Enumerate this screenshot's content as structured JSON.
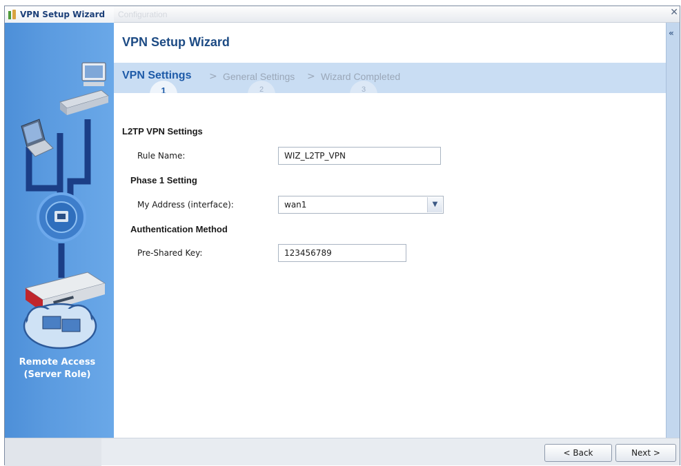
{
  "caption_fragment": "",
  "window": {
    "title": "VPN Setup Wizard",
    "ghost_tab": "Configuration"
  },
  "sidebar": {
    "caption_line1": "Remote Access",
    "caption_line2": "(Server Role)"
  },
  "wizard": {
    "title": "VPN Setup Wizard",
    "steps": [
      {
        "label": "VPN Settings",
        "number": "1",
        "active": true
      },
      {
        "label": "General Settings",
        "number": "2",
        "active": false
      },
      {
        "label": "Wizard Completed",
        "number": "3",
        "active": false
      }
    ],
    "separator": ">"
  },
  "form": {
    "section_l2tp": "L2TP VPN Settings",
    "rule_name_label": "Rule Name:",
    "rule_name_value": "WIZ_L2TP_VPN",
    "section_phase1": "Phase 1 Setting",
    "my_address_label": "My Address (interface):",
    "my_address_value": "wan1",
    "section_auth": "Authentication Method",
    "psk_label": "Pre-Shared Key:",
    "psk_value": "123456789"
  },
  "footer": {
    "back_label": "< Back",
    "next_label": "Next >"
  },
  "icons": {
    "close": "close-icon",
    "collapse": "double-chevron-left-icon",
    "dropdown": "chevron-down-icon"
  },
  "colors": {
    "accent": "#1d4b84",
    "step_bar": "#c9ddf3",
    "sidebar": "#5b9be0"
  }
}
